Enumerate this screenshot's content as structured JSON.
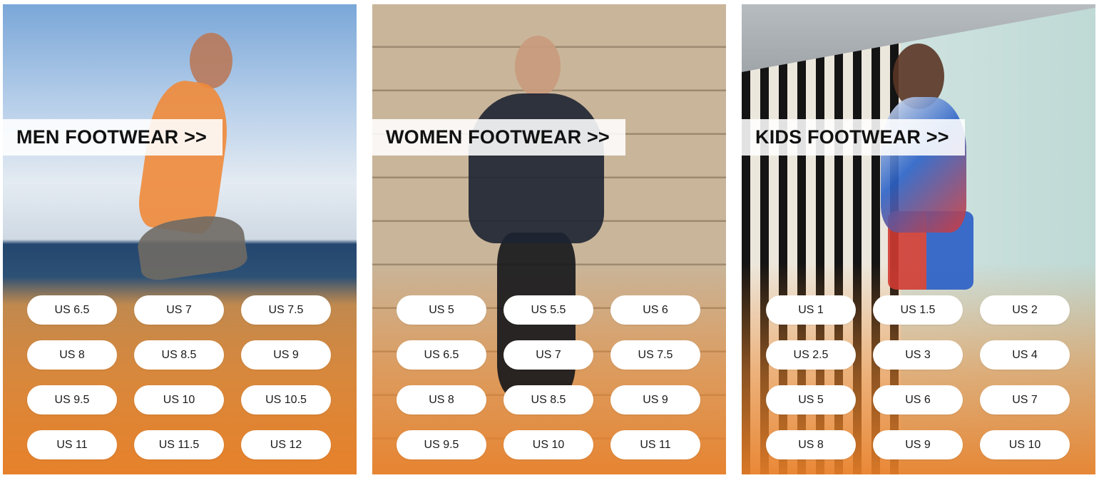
{
  "categories": [
    {
      "title": "MEN FOOTWEAR >>",
      "sizes": [
        "US 6.5",
        "US 7",
        "US 7.5",
        "US 8",
        "US 8.5",
        "US 9",
        "US 9.5",
        "US 10",
        "US 10.5",
        "US 11",
        "US 11.5",
        "US 12"
      ]
    },
    {
      "title": "WOMEN FOOTWEAR >>",
      "sizes": [
        "US 5",
        "US 5.5",
        "US 6",
        "US 6.5",
        "US 7",
        "US 7.5",
        "US 8",
        "US 8.5",
        "US 9",
        "US 9.5",
        "US 10",
        "US 11"
      ]
    },
    {
      "title": "KIDS FOOTWEAR >>",
      "sizes": [
        "US 1",
        "US 1.5",
        "US 2",
        "US 2.5",
        "US 3",
        "US 4",
        "US 5",
        "US 6",
        "US 7",
        "US 8",
        "US 9",
        "US 10"
      ]
    }
  ],
  "colors": {
    "banner_bg": "#ffffff",
    "banner_text": "#111111",
    "pill_bg": "#ffffff",
    "pill_text": "#1a1a1a",
    "overlay_orange": "#e98028"
  }
}
